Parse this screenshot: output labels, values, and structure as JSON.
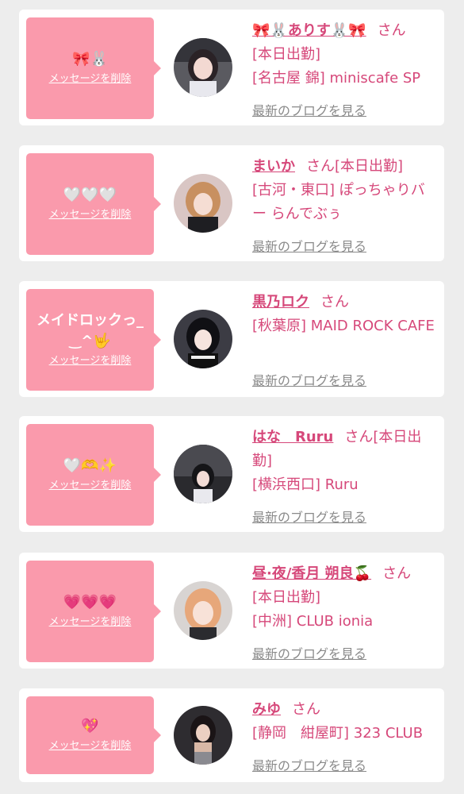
{
  "colors": {
    "accent": "#d6487a",
    "bubble": "#fa9aac",
    "background": "#ededed",
    "card": "#ffffff",
    "link_gray": "#8a8a8a"
  },
  "labels": {
    "delete_message": "メッセージを削除",
    "latest_blog": "最新のブログを見る",
    "honorific": "さん"
  },
  "entries": [
    {
      "message": "🎀🐰",
      "name": "🎀🐰ありす🐰🎀",
      "status": "[本日出勤]",
      "shop": "[名古屋 錦] miniscafe SP",
      "avatar_icon": "girl-photo-avatar"
    },
    {
      "message": "🤍🤍🤍",
      "name": "まいか",
      "status": "[本日出勤]",
      "shop": "[古河・東口] ぽっちゃりバー らんでぶぅ",
      "avatar_icon": "girl-photo-avatar"
    },
    {
      "message": "メイドロックっ_ ‿^🤟",
      "name": "黒乃ロク",
      "status": "",
      "shop": "[秋葉原] MAID ROCK CAFE",
      "avatar_icon": "girl-photo-avatar"
    },
    {
      "message": "🤍🫶✨",
      "name": "はな　Ruru",
      "status": "[本日出勤]",
      "shop": "[横浜西口] Ruru",
      "avatar_icon": "girl-photo-avatar"
    },
    {
      "message": "💗💗💗",
      "name": "昼·夜/香月 朔良🍒",
      "status": "[本日出勤]",
      "shop": "[中洲] CLUB ionia",
      "avatar_icon": "girl-photo-avatar"
    },
    {
      "message": "💖",
      "name": "みゆ",
      "status": "",
      "shop": "[静岡　紺屋町] 323 CLUB",
      "avatar_icon": "girl-photo-avatar"
    }
  ]
}
